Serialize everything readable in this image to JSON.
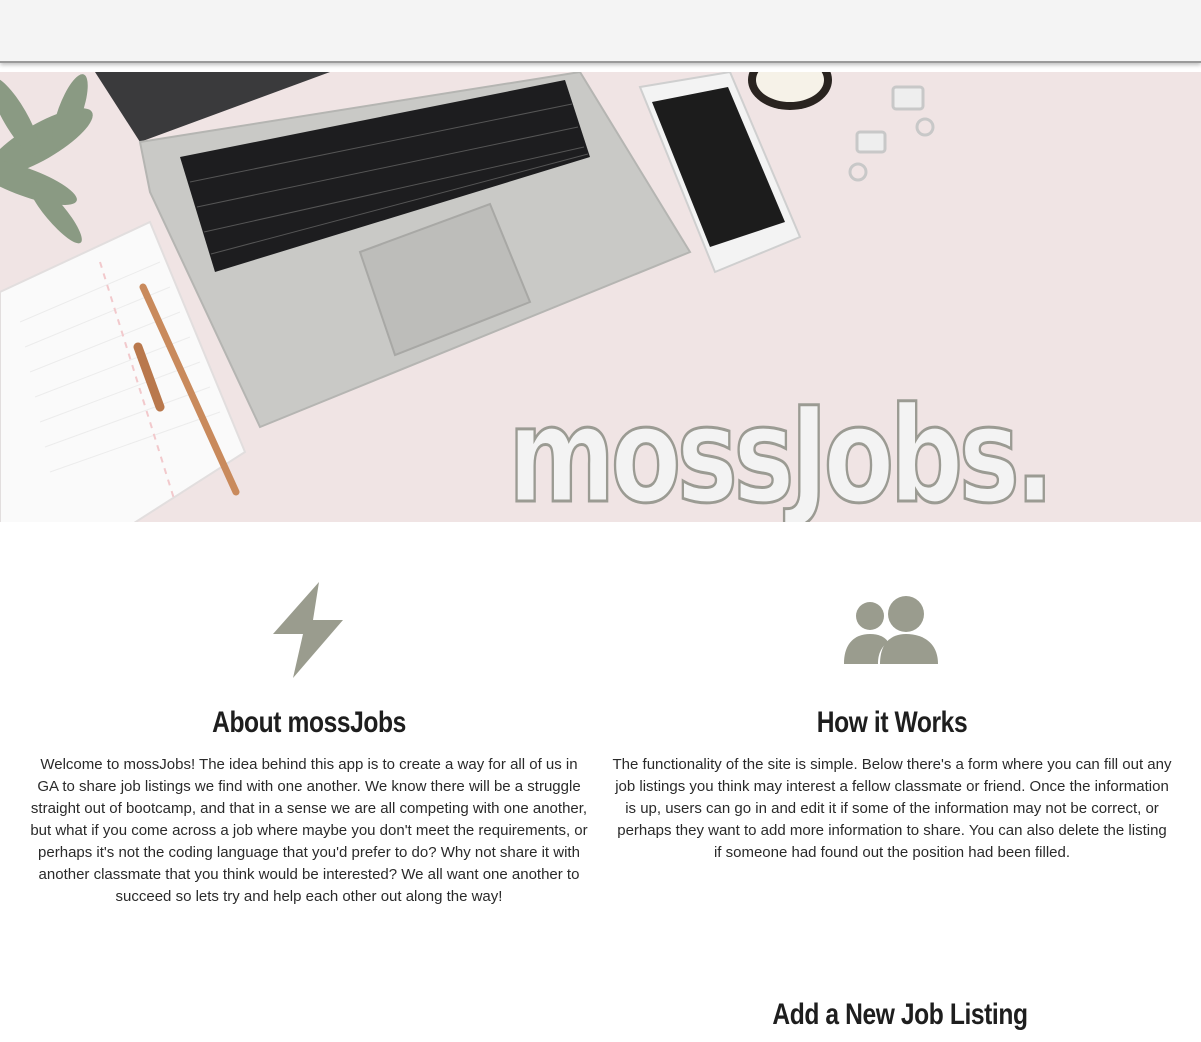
{
  "hero": {
    "brand": "mossJobs."
  },
  "features": [
    {
      "icon": "lightning-bolt-icon",
      "title": "About mossJobs",
      "text": "Welcome to mossJobs! The idea behind this app is to create a way for all of us in GA to share job listings we find with one another. We know there will be a struggle straight out of bootcamp, and that in a sense we are all competing with one another, but what if you come across a job where maybe you don't meet the requirements, or perhaps it's not the coding language that you'd prefer to do? Why not share it with another classmate that you think would be interested? We all want one another to succeed so lets try and help each other out along the way!"
    },
    {
      "icon": "people-icon",
      "title": "How it Works",
      "text": "The functionality of the site is simple. Below there's a form where you can fill out any job listings you think may interest a fellow classmate or friend. Once the information is up, users can go in and edit it if some of the information may not be correct, or perhaps they want to add more information to share. You can also delete the listing if someone had found out the position had been filled."
    }
  ],
  "form": {
    "title": "Add a New Job Listing"
  },
  "colors": {
    "accent": "#9a9c8e",
    "hero_bg": "#f0e4e4",
    "topbar": "#f4f4f4"
  }
}
